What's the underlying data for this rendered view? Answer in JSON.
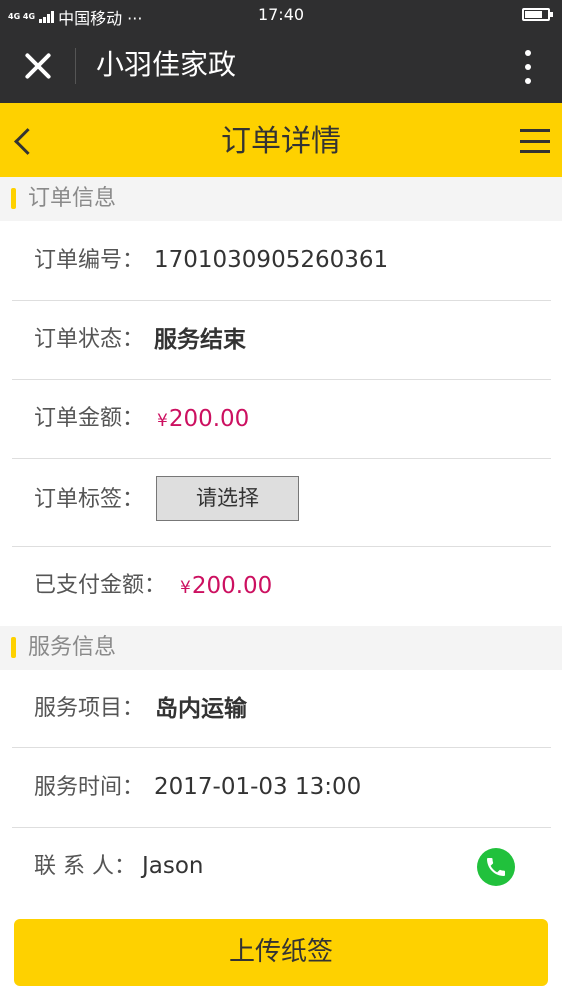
{
  "status_bar": {
    "network": "4G 4G",
    "carrier": "中国移动 ···",
    "time": "17:40"
  },
  "wechat_bar": {
    "title": "小羽佳家政"
  },
  "header": {
    "title": "订单详情"
  },
  "order_section": {
    "title": "订单信息",
    "order_no_label": "订单编号：",
    "order_no": "1701030905260361",
    "status_label": "订单状态：",
    "status": "服务结束",
    "amount_label": "订单金额：",
    "amount_currency": "¥",
    "amount": "200.00",
    "tag_label": "订单标签：",
    "tag_select": "请选择",
    "paid_label": "已支付金额：",
    "paid_currency": "¥",
    "paid": "200.00"
  },
  "service_section": {
    "title": "服务信息",
    "item_label": "服务项目：",
    "item": "岛内运输",
    "time_label": "服务时间：",
    "time": "2017-01-03 13:00",
    "contact_label": "联 系 人：",
    "contact": "Jason"
  },
  "bottom": {
    "upload_label": "上传纸签"
  },
  "colors": {
    "accent": "#fed100",
    "money": "#cc1060",
    "phone": "#21c13c",
    "topbar": "#2f2f30"
  },
  "icons": [
    "signal-icon",
    "battery-icon",
    "close-icon",
    "more-vertical-icon",
    "back-arrow-icon",
    "menu-icon",
    "phone-icon"
  ]
}
